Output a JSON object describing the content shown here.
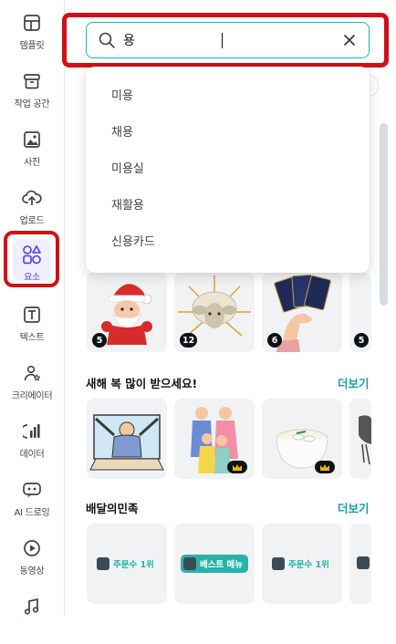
{
  "sidebar": {
    "items": [
      {
        "label": "템플릿",
        "icon": "template-icon"
      },
      {
        "label": "작업 공간",
        "icon": "folder-icon"
      },
      {
        "label": "사진",
        "icon": "photo-icon"
      },
      {
        "label": "업로드",
        "icon": "upload-cloud-icon"
      },
      {
        "label": "요소",
        "icon": "elements-icon"
      },
      {
        "label": "텍스트",
        "icon": "text-icon"
      },
      {
        "label": "크리에이터",
        "icon": "creator-icon"
      },
      {
        "label": "데이터",
        "icon": "data-chart-icon"
      },
      {
        "label": "AI 드로잉",
        "icon": "ai-drawing-icon"
      },
      {
        "label": "동영상",
        "icon": "video-play-icon"
      },
      {
        "label": "",
        "icon": "music-icon"
      }
    ],
    "active_index": 4
  },
  "search": {
    "value": "용",
    "placeholder": ""
  },
  "suggestions": [
    "미용",
    "채용",
    "미용실",
    "재활용",
    "신용카드"
  ],
  "first_row_counts": [
    "5",
    "12",
    "6",
    "5"
  ],
  "sections": [
    {
      "title": "새해 복 많이 받으세요!",
      "more": "더보기"
    },
    {
      "title": "배달의민족",
      "more": "더보기"
    }
  ],
  "promo_tiles": [
    "주문수 1위",
    "베스트 메뉴",
    "주문수 1위"
  ],
  "colors": {
    "accent_teal": "#1ab5c5",
    "highlight_red": "#d10f16",
    "promo_teal": "#28b3a8",
    "active_purple": "#5a32fa"
  }
}
